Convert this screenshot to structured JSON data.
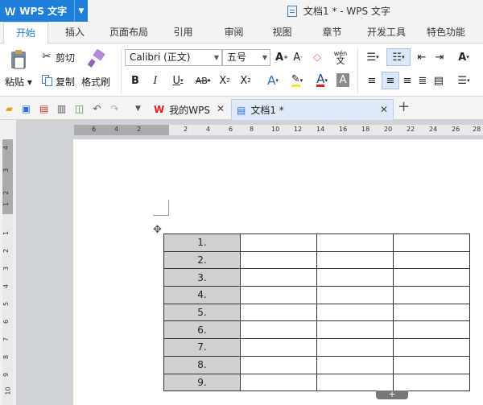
{
  "app": {
    "name": "WPS 文字",
    "window_title": "文档1 * - WPS 文字"
  },
  "menu": {
    "tabs": [
      "开始",
      "插入",
      "页面布局",
      "引用",
      "审阅",
      "视图",
      "章节",
      "开发工具",
      "特色功能"
    ]
  },
  "ribbon": {
    "paste": "粘贴",
    "cut": "剪切",
    "copy": "复制",
    "format_painter": "格式刷",
    "font_name": "Calibri (正文)",
    "font_size": "五号",
    "wen": "wén",
    "wen_char": "文"
  },
  "doc_tabs": [
    {
      "label": "我的WPS"
    },
    {
      "label": "文档1 *"
    }
  ],
  "hruler_numbers": [
    "6",
    "4",
    "2",
    "2",
    "4",
    "6",
    "8",
    "10",
    "12",
    "14",
    "16",
    "18",
    "20",
    "22",
    "24",
    "26",
    "28"
  ],
  "vruler_numbers": [
    "4",
    "3",
    "2",
    "1",
    "1",
    "2",
    "3",
    "4",
    "5",
    "6",
    "7",
    "8",
    "9",
    "10"
  ],
  "table": {
    "rows": [
      "1.",
      "2.",
      "3.",
      "4.",
      "5.",
      "6.",
      "7.",
      "8.",
      "9."
    ],
    "extra_columns": 3
  },
  "colors": {
    "accent": "#1e7ed8",
    "numbered_cell": "#d0d0d0",
    "font_color_red": "#e02020"
  },
  "icons": [
    "wps-logo-icon",
    "paste-icon",
    "cut-icon",
    "copy-icon",
    "format-painter-icon",
    "font-grow-icon",
    "font-shrink-icon",
    "clear-format-icon",
    "pinyin-icon",
    "bold-icon",
    "italic-icon",
    "underline-icon",
    "strikethrough-icon",
    "superscript-icon",
    "subscript-icon",
    "text-effect-icon",
    "highlight-icon",
    "font-color-icon",
    "char-shade-icon",
    "bullet-list-icon",
    "numbered-list-icon",
    "decrease-indent-icon",
    "increase-indent-icon",
    "align-left-icon",
    "align-center-icon",
    "align-right-icon",
    "justify-icon",
    "distribute-icon",
    "line-spacing-icon",
    "open-icon",
    "save-icon",
    "pdf-icon",
    "print-icon",
    "preview-icon",
    "undo-icon",
    "redo-icon",
    "table-move-icon"
  ]
}
